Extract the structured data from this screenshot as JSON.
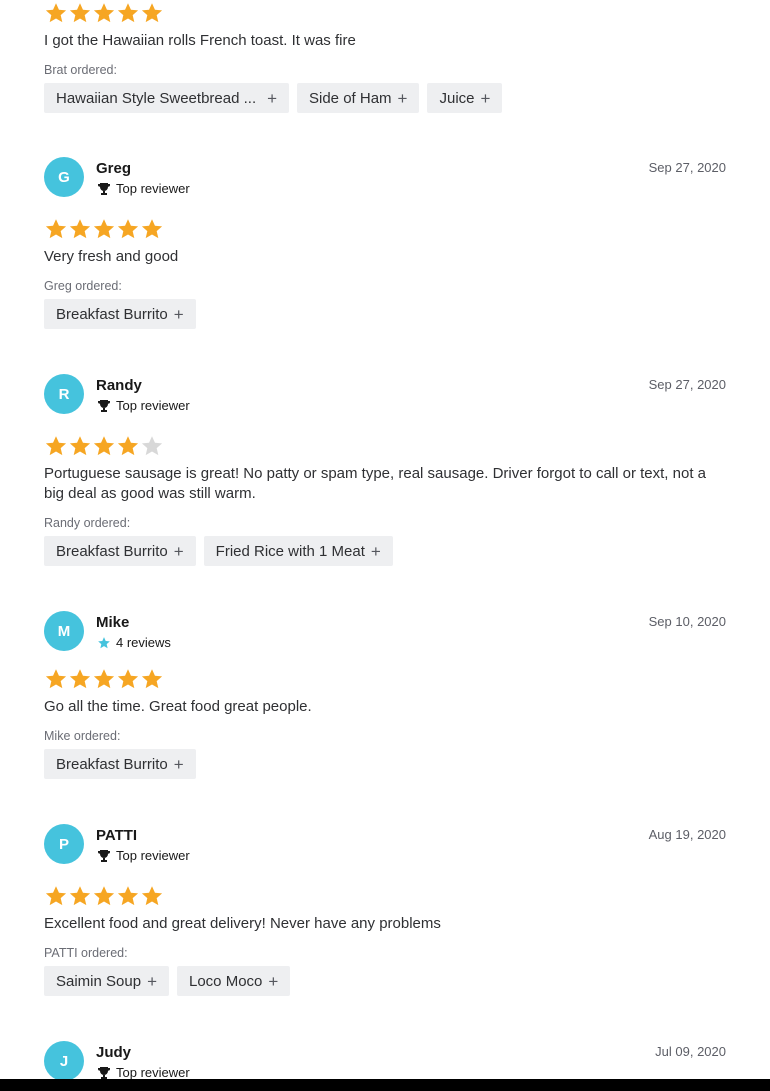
{
  "colors": {
    "accent": "#45c3dd",
    "star_on": "#f6a623",
    "star_off": "#d8d8d8",
    "chip_bg": "#eeeff1"
  },
  "partial_review": {
    "rating": 5,
    "text": "I got the Hawaiian rolls French toast. It was fire",
    "ordered_label": "Brat ordered:",
    "items": [
      "Hawaiian Style Sweetbread ...",
      "Side of Ham",
      "Juice"
    ]
  },
  "reviews": [
    {
      "initial": "G",
      "name": "Greg",
      "badge_icon": "trophy-icon",
      "badge": "Top reviewer",
      "date": "Sep 27, 2020",
      "rating": 5,
      "text": "Very fresh and good",
      "ordered_label": "Greg ordered:",
      "items": [
        "Breakfast Burrito"
      ]
    },
    {
      "initial": "R",
      "name": "Randy",
      "badge_icon": "trophy-icon",
      "badge": "Top reviewer",
      "date": "Sep 27, 2020",
      "rating": 4,
      "text": "Portuguese sausage is great! No patty or spam type, real sausage. Driver forgot to call or text, not a big deal as good was still warm.",
      "ordered_label": "Randy ordered:",
      "items": [
        "Breakfast Burrito",
        "Fried Rice with 1 Meat"
      ]
    },
    {
      "initial": "M",
      "name": "Mike",
      "badge_icon": "star-icon",
      "badge": "4 reviews",
      "date": "Sep 10, 2020",
      "rating": 5,
      "text": "Go all the time. Great food great people.",
      "ordered_label": "Mike ordered:",
      "items": [
        "Breakfast Burrito"
      ]
    },
    {
      "initial": "P",
      "name": "PATTI",
      "badge_icon": "trophy-icon",
      "badge": "Top reviewer",
      "date": "Aug 19, 2020",
      "rating": 5,
      "text": "Excellent food and great delivery! Never have any problems",
      "ordered_label": "PATTI ordered:",
      "items": [
        "Saimin Soup",
        "Loco Moco"
      ]
    },
    {
      "initial": "J",
      "name": "Judy",
      "badge_icon": "trophy-icon",
      "badge": "Top reviewer",
      "date": "Jul 09, 2020"
    }
  ]
}
